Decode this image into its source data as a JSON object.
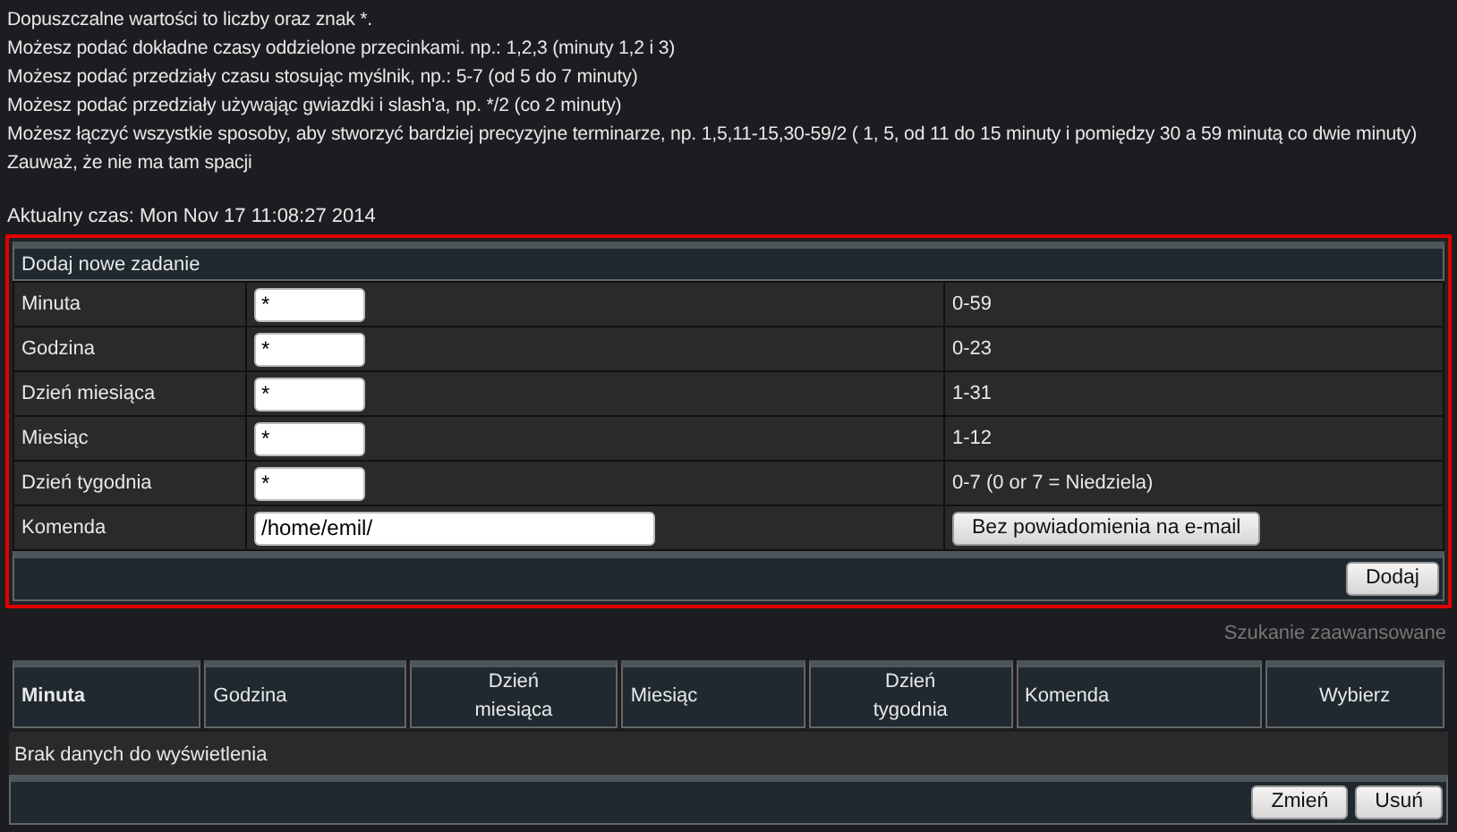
{
  "help_lines": [
    "Dopuszczalne wartości to liczby oraz znak *.",
    "Możesz podać dokładne czasy oddzielone przecinkami. np.: 1,2,3 (minuty 1,2 i 3)",
    "Możesz podać przedziały czasu stosując myślnik, np.: 5-7 (od 5 do 7 minuty)",
    "Możesz podać przedziały używając gwiazdki i slash'a, np. */2 (co 2 minuty)",
    "Możesz łączyć wszystkie sposoby, aby stworzyć bardziej precyzyjne terminarze, np. 1,5,11-15,30-59/2 ( 1, 5, od 11 do 15 minuty i pomiędzy 30 a 59 minutą co dwie minuty)",
    "Zauważ, że nie ma tam spacji"
  ],
  "current_time": "Aktualny czas: Mon Nov 17 11:08:27 2014",
  "add_form": {
    "title": "Dodaj nowe zadanie",
    "fields": [
      {
        "label": "Minuta",
        "value": "*",
        "hint": "0-59",
        "kind": "short"
      },
      {
        "label": "Godzina",
        "value": "*",
        "hint": "0-23",
        "kind": "short"
      },
      {
        "label": "Dzień miesiąca",
        "value": "*",
        "hint": "1-31",
        "kind": "short"
      },
      {
        "label": "Miesiąc",
        "value": "*",
        "hint": "1-12",
        "kind": "short"
      },
      {
        "label": "Dzień tygodnia",
        "value": "*",
        "hint": "0-7 (0 or 7 = Niedziela)",
        "kind": "short"
      },
      {
        "label": "Komenda",
        "value": "/home/emil/",
        "button": "Bez powiadomienia na e-mail",
        "kind": "long"
      }
    ],
    "submit": "Dodaj"
  },
  "advanced_search": "Szukanie zaawansowane",
  "table": {
    "columns": [
      {
        "label": "Minuta",
        "sorted": true,
        "kind": "plain"
      },
      {
        "label": "Godzina",
        "sorted": false,
        "kind": "plain"
      },
      {
        "label": "Dzień miesiąca",
        "sorted": false,
        "kind": "stacked"
      },
      {
        "label": "Miesiąc",
        "sorted": false,
        "kind": "plain"
      },
      {
        "label": "Dzień tygodnia",
        "sorted": false,
        "kind": "stacked"
      },
      {
        "label": "Komenda",
        "sorted": false,
        "kind": "plain"
      },
      {
        "label": "Wybierz",
        "sorted": false,
        "kind": "action"
      }
    ],
    "empty_message": "Brak danych do wyświetlenia",
    "buttons": [
      "Zmień",
      "Usuń"
    ]
  }
}
